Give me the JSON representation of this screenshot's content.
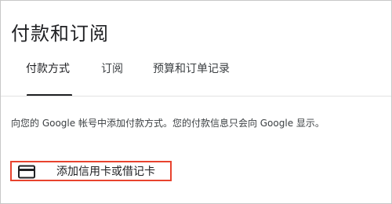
{
  "page": {
    "title": "付款和订阅"
  },
  "tabs": [
    {
      "label": "付款方式",
      "active": true
    },
    {
      "label": "订阅",
      "active": false
    },
    {
      "label": "预算和订单记录",
      "active": false
    }
  ],
  "main": {
    "description": "向您的 Google 帐号中添加付款方式。您的付款信息只会向 Google 显示。",
    "add_card": {
      "label": "添加信用卡或借记卡",
      "icon": "credit-card-icon",
      "highlight_color": "#e8432e"
    }
  },
  "colors": {
    "text_primary": "#202124",
    "text_secondary": "#3c4043",
    "divider": "#e3e3e3"
  }
}
